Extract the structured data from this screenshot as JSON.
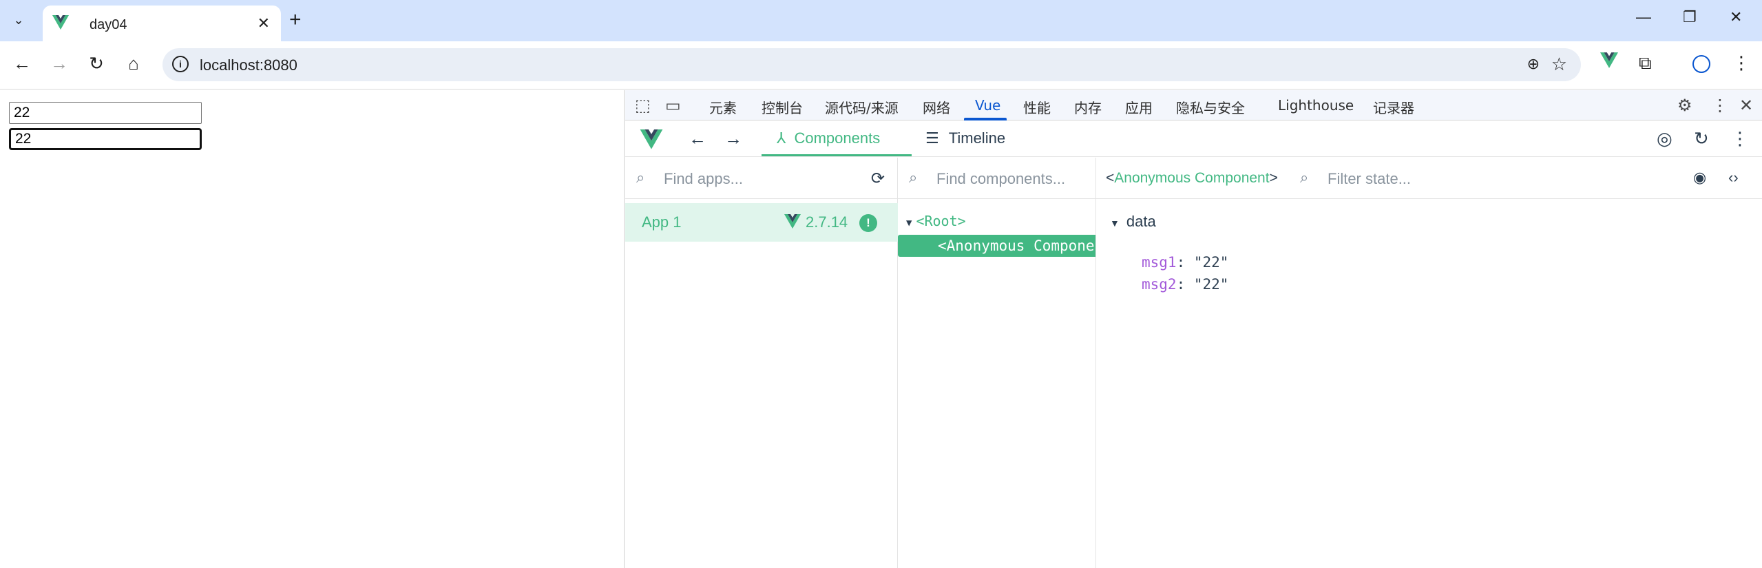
{
  "browser": {
    "tab_title": "day04",
    "url": "localhost:8080"
  },
  "page": {
    "input1_value": "22",
    "input2_value": "22"
  },
  "devtools": {
    "tabs": [
      "元素",
      "控制台",
      "源代码/来源",
      "网络",
      "Vue",
      "性能",
      "内存",
      "应用",
      "隐私与安全",
      "Lighthouse",
      "记录器"
    ],
    "active_tab": "Vue",
    "vue": {
      "tab_components": "Components",
      "tab_timeline": "Timeline",
      "apps_placeholder": "Find apps...",
      "components_placeholder": "Find components...",
      "state_placeholder": "Filter state...",
      "app": {
        "name": "App 1",
        "version": "2.7.14"
      },
      "tree": {
        "root": "<Root>",
        "selected": "<Anonymous Component>"
      },
      "selected_component": "Anonymous Component",
      "state": {
        "section": "data",
        "props": [
          {
            "key": "msg1",
            "value": "\"22\""
          },
          {
            "key": "msg2",
            "value": "\"22\""
          }
        ]
      }
    }
  },
  "colors": {
    "vue_green": "#42b883",
    "vue_dark": "#35495e",
    "chrome_blue": "#0b57d0",
    "tabstrip": "#d3e3fd"
  },
  "icons": {
    "tab_search": "chevron-down-icon",
    "back": "arrow-left-icon",
    "forward": "arrow-right-icon",
    "reload": "reload-icon",
    "home": "home-icon",
    "zoom": "zoom-icon",
    "bookmark": "star-icon",
    "extensions": "puzzle-icon",
    "profile": "profile-icon",
    "menu": "kebab-icon"
  }
}
